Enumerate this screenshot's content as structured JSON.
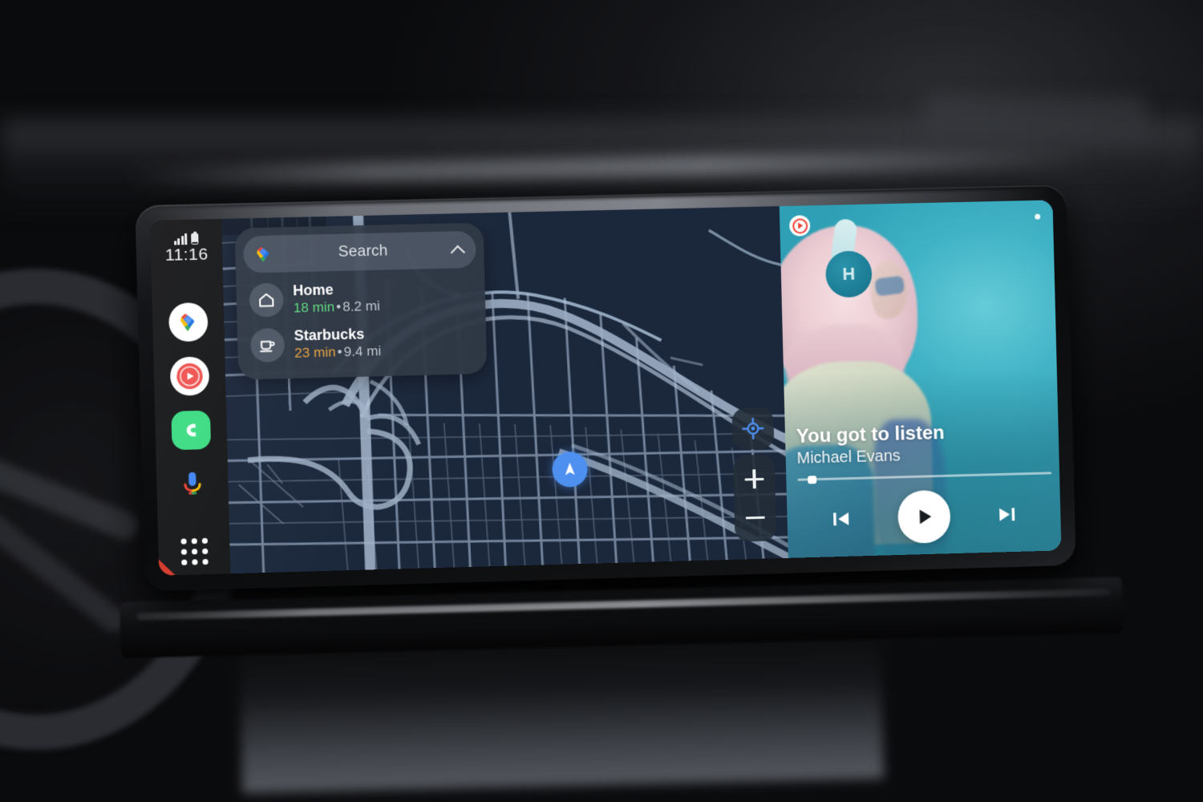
{
  "status": {
    "time": "11:16",
    "signal_icon": "signal-bars-icon",
    "battery_icon": "battery-icon"
  },
  "sidebar": {
    "items": [
      {
        "name": "maps-app",
        "icon": "google-maps-icon",
        "label": "Maps"
      },
      {
        "name": "youtube-music-app",
        "icon": "youtube-music-icon",
        "label": "YouTube Music"
      },
      {
        "name": "phone-app",
        "icon": "phone-icon",
        "label": "Phone"
      },
      {
        "name": "assistant",
        "icon": "google-assistant-mic-icon",
        "label": "Assistant"
      },
      {
        "name": "app-grid",
        "icon": "apps-grid-icon",
        "label": "Apps"
      }
    ]
  },
  "map": {
    "search": {
      "placeholder": "Search",
      "label": "Search",
      "app_icon": "google-maps-pin-icon",
      "expand_icon": "chevron-up-icon"
    },
    "destinations": [
      {
        "name": "Home",
        "icon": "home-icon",
        "eta": "18 min",
        "eta_color": "#5fd97f",
        "separator": "•",
        "distance": "8.2 mi"
      },
      {
        "name": "Starbucks",
        "icon": "coffee-cup-icon",
        "eta": "23 min",
        "eta_color": "#e8a33d",
        "separator": "•",
        "distance": "9.4 mi"
      }
    ],
    "controls": {
      "recenter_icon": "recenter-crosshair-icon",
      "zoom_in_label": "+",
      "zoom_out_label": "−"
    },
    "vehicle_marker_icon": "navigation-arrow-icon"
  },
  "media": {
    "source_badge_icon": "youtube-music-badge-icon",
    "album_art_letter": "H",
    "title": "You got to listen",
    "artist": "Michael Evans",
    "progress_percent": 4,
    "controls": {
      "previous_icon": "skip-previous-icon",
      "play_icon": "play-icon",
      "next_icon": "skip-next-icon"
    }
  },
  "colors": {
    "map_background": "#1d2a3d",
    "map_road": "#93a4bb",
    "accent_blue": "#4d90f0",
    "media_background": "#39b2c4",
    "sidebar_background": "#17181a"
  }
}
